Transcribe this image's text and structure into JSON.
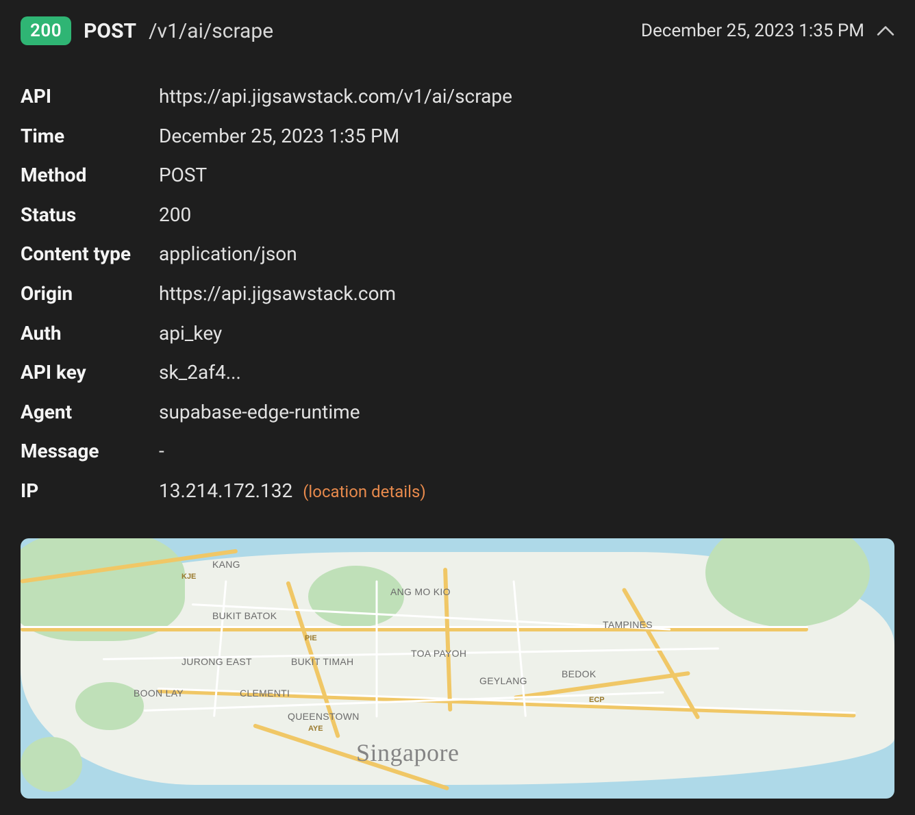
{
  "header": {
    "status": "200",
    "method": "POST",
    "path": "/v1/ai/scrape",
    "timestamp": "December 25, 2023 1:35 PM"
  },
  "details": {
    "api": {
      "label": "API",
      "value": "https://api.jigsawstack.com/v1/ai/scrape"
    },
    "time": {
      "label": "Time",
      "value": "December 25, 2023 1:35 PM"
    },
    "method": {
      "label": "Method",
      "value": "POST"
    },
    "status": {
      "label": "Status",
      "value": "200"
    },
    "content_type": {
      "label": "Content type",
      "value": "application/json"
    },
    "origin": {
      "label": "Origin",
      "value": "https://api.jigsawstack.com"
    },
    "auth": {
      "label": "Auth",
      "value": "api_key"
    },
    "api_key": {
      "label": "API key",
      "value": "sk_2af4..."
    },
    "agent": {
      "label": "Agent",
      "value": "supabase-edge-runtime"
    },
    "message": {
      "label": "Message",
      "value": "-"
    },
    "ip": {
      "label": "IP",
      "value": "13.214.172.132",
      "link_text": "(location details)"
    }
  },
  "map": {
    "city": "Singapore",
    "places": [
      "KANG",
      "ANG MO KIO",
      "BUKIT BATOK",
      "TAMPINES",
      "JURONG EAST",
      "BUKIT TIMAH",
      "TOA PAYOH",
      "BEDOK",
      "GEYLANG",
      "BOON LAY",
      "CLEMENTI",
      "QUEENSTOWN"
    ],
    "shields": [
      "KJE",
      "PIE",
      "AYE",
      "ECP"
    ]
  }
}
